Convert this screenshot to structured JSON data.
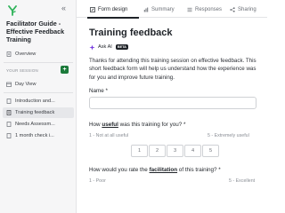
{
  "sidebar": {
    "title": "Facilitator Guide - Effective Feedback Training",
    "collapse_icon": "«",
    "top_items": [
      {
        "label": "Overview",
        "icon": "document-icon"
      }
    ],
    "section_label": "YOUR SESSION",
    "add_label": "+",
    "session_items": [
      {
        "label": "Day View",
        "icon": "calendar-icon"
      }
    ],
    "doc_items": [
      {
        "label": "Introduction and...",
        "icon": "document-icon",
        "active": false
      },
      {
        "label": "Training feedback",
        "icon": "form-icon",
        "active": true
      },
      {
        "label": "Needs Assessm...",
        "icon": "document-icon",
        "active": false
      },
      {
        "label": "1 month check i...",
        "icon": "document-icon",
        "active": false
      }
    ]
  },
  "tabs": [
    {
      "label": "Form design",
      "icon": "edit-icon",
      "active": true
    },
    {
      "label": "Summary",
      "icon": "chart-icon",
      "active": false
    },
    {
      "label": "Responses",
      "icon": "list-icon",
      "active": false
    },
    {
      "label": "Sharing",
      "icon": "share-icon",
      "active": false
    }
  ],
  "form": {
    "title": "Training feedback",
    "ask_ai_label": "Ask AI",
    "beta_label": "BETA",
    "description": "Thanks for attending this training session on effective feedback. This short feedback form will help us understand how the experience was for you and improve future training.",
    "name_label": "Name *",
    "q1": {
      "prefix": "How ",
      "emphasis": "useful",
      "suffix": " was this training for you? *",
      "low": "1 - Not at all useful",
      "high": "5 - Extremely useful",
      "options": [
        "1",
        "2",
        "3",
        "4",
        "5"
      ]
    },
    "q2": {
      "prefix": "How would you rate the ",
      "emphasis": "facilitation",
      "suffix": " of this training? *",
      "low": "1 - Poor",
      "high": "5 - Excellent"
    }
  },
  "colors": {
    "brand_green": "#1b7a3a",
    "logo_green": "#2fb35a"
  }
}
